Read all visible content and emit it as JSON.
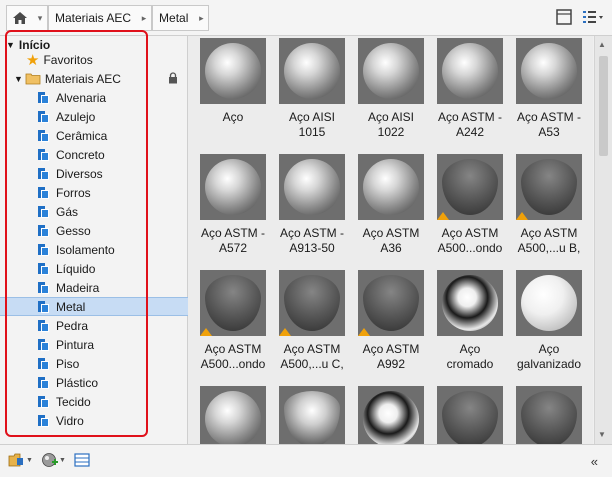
{
  "breadcrumb": {
    "home_icon": "home-icon",
    "segments": [
      "Materiais AEC",
      "Metal"
    ]
  },
  "toolbar": {
    "view_icon": "view-toggle-icon",
    "list_icon": "list-view-icon"
  },
  "tree": {
    "root_label": "Início",
    "favorites_label": "Favoritos",
    "library_label": "Materiais AEC",
    "categories": [
      "Alvenaria",
      "Azulejo",
      "Cerâmica",
      "Concreto",
      "Diversos",
      "Forros",
      "Gás",
      "Gesso",
      "Isolamento",
      "Líquido",
      "Madeira",
      "Metal",
      "Pedra",
      "Pintura",
      "Piso",
      "Plástico",
      "Tecido",
      "Vidro"
    ],
    "selected": "Metal"
  },
  "materials": [
    {
      "label": "Aço",
      "style": "metal",
      "warning": false
    },
    {
      "label": "Aço AISI\n1015",
      "style": "metal",
      "warning": false
    },
    {
      "label": "Aço AISI\n1022",
      "style": "metal",
      "warning": false
    },
    {
      "label": "Aço ASTM -\nA242",
      "style": "metal",
      "warning": false
    },
    {
      "label": "Aço ASTM -\nA53",
      "style": "metal",
      "warning": false
    },
    {
      "label": "Aço ASTM -\nA572",
      "style": "metal",
      "warning": false
    },
    {
      "label": "Aço ASTM -\nA913-50",
      "style": "metal",
      "warning": false
    },
    {
      "label": "Aço ASTM\nA36",
      "style": "metal",
      "warning": false
    },
    {
      "label": "Aço ASTM\nA500...ondo",
      "style": "rough-pointed",
      "warning": true
    },
    {
      "label": "Aço ASTM\nA500,...u B,",
      "style": "rough-pointed",
      "warning": true
    },
    {
      "label": "Aço ASTM\nA500...ondo",
      "style": "rough-pointed",
      "warning": true
    },
    {
      "label": "Aço ASTM\nA500,...u C,",
      "style": "rough-pointed",
      "warning": true
    },
    {
      "label": "Aço ASTM\nA992",
      "style": "rough-pointed",
      "warning": true
    },
    {
      "label": "Aço\ncromado",
      "style": "chrome",
      "warning": false
    },
    {
      "label": "Aço\ngalvanizado",
      "style": "galv",
      "warning": false
    },
    {
      "label": "",
      "style": "metal",
      "warning": false
    },
    {
      "label": "",
      "style": "spike",
      "warning": false
    },
    {
      "label": "",
      "style": "chrome",
      "warning": false
    },
    {
      "label": "",
      "style": "rough-pointed",
      "warning": false
    },
    {
      "label": "",
      "style": "rough-pointed",
      "warning": false
    }
  ],
  "bottombar": {
    "library_menu_icon": "library-menu-icon",
    "create_material_icon": "create-material-icon",
    "panel_toggle_icon": "panel-toggle-icon",
    "collapse_icon": "collapse-left-icon"
  }
}
